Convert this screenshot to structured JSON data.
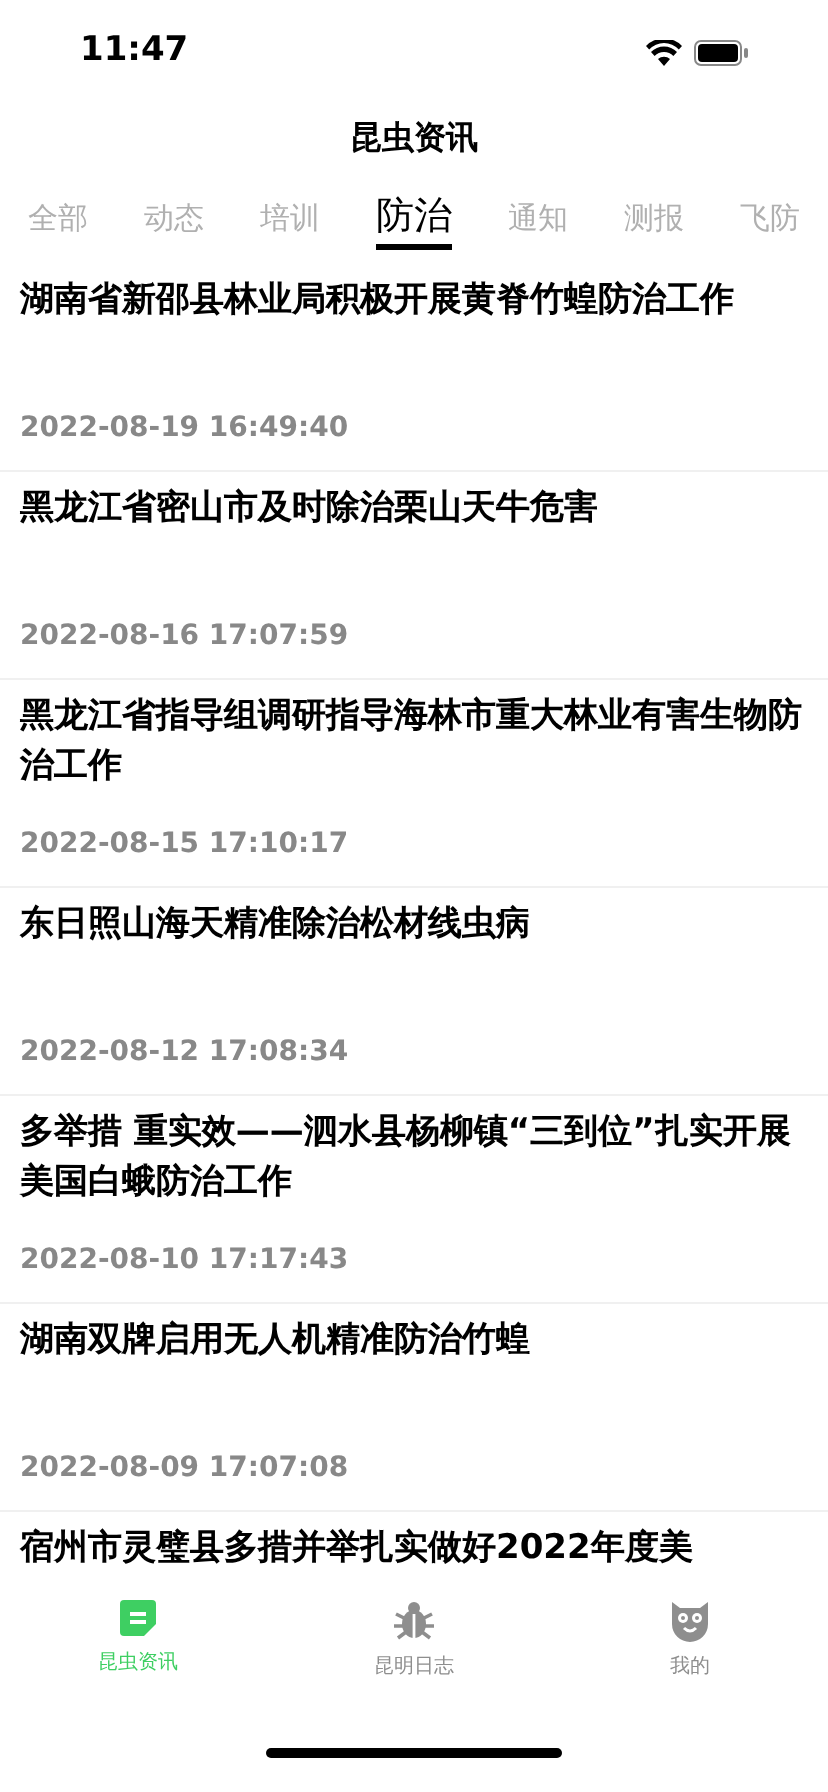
{
  "status_bar": {
    "time": "11:47"
  },
  "header": {
    "title": "昆虫资讯"
  },
  "tabs": [
    {
      "label": "全部",
      "selected": false
    },
    {
      "label": "动态",
      "selected": false
    },
    {
      "label": "培训",
      "selected": false
    },
    {
      "label": "防治",
      "selected": true
    },
    {
      "label": "通知",
      "selected": false
    },
    {
      "label": "测报",
      "selected": false
    },
    {
      "label": "飞防",
      "selected": false
    }
  ],
  "articles": [
    {
      "title": "湖南省新邵县林业局积极开展黄脊竹蝗防治工作",
      "date": "2022-08-19 16:49:40"
    },
    {
      "title": "黑龙江省密山市及时除治栗山天牛危害",
      "date": "2022-08-16 17:07:59"
    },
    {
      "title": "黑龙江省指导组调研指导海林市重大林业有害生物防治工作",
      "date": "2022-08-15 17:10:17"
    },
    {
      "title": "东日照山海天精准除治松材线虫病",
      "date": "2022-08-12 17:08:34"
    },
    {
      "title": "多举措 重实效——泗水县杨柳镇“三到位”扎实开展美国白蛾防治工作",
      "date": "2022-08-10 17:17:43"
    },
    {
      "title": "湖南双牌启用无人机精准防治竹蝗",
      "date": "2022-08-09 17:07:08"
    },
    {
      "title": "宿州市灵璧县多措并举扎实做好2022年度美"
    }
  ],
  "tab_bar": [
    {
      "label": "昆虫资讯",
      "kind": "news",
      "selected": true
    },
    {
      "label": "昆明日志",
      "kind": "bug",
      "selected": false
    },
    {
      "label": "我的",
      "kind": "owl",
      "selected": false
    }
  ]
}
